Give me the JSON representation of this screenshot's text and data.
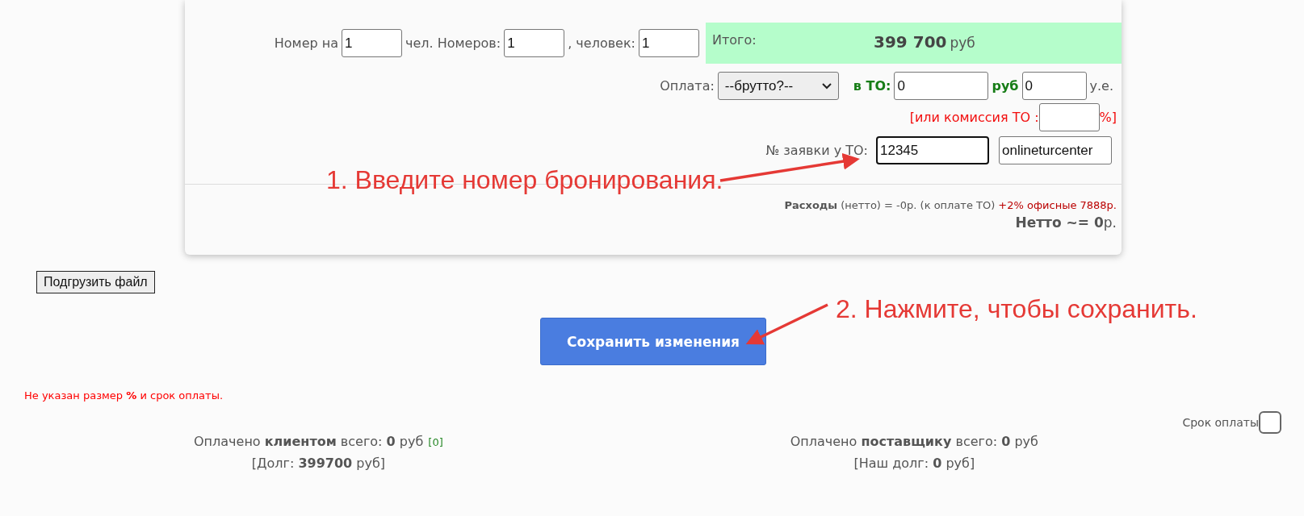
{
  "room_row": {
    "fields": [
      {
        "label": "Номер на",
        "value": "1"
      },
      {
        "label": "чел. Номеров:",
        "value": "1"
      },
      {
        "label": ", человек:",
        "value": "1"
      }
    ]
  },
  "total": {
    "label": "Итого:",
    "amount": "399 700",
    "currency": "руб"
  },
  "payment": {
    "label": "Оплата:",
    "select": "--брутто?--",
    "to_label": "в ТО:",
    "to_value": "0",
    "rub_label": "руб",
    "ue_value": "0",
    "ue_label": "у.е."
  },
  "commission": {
    "label": "[или комиссия ТО :",
    "suffix": "%]"
  },
  "order": {
    "label": "№ заявки у ТО:",
    "value": "12345",
    "focused": true,
    "operator": "onlineturcenter"
  },
  "expenses": {
    "text": "**Расходы** (нетто) = -0р. (к оплате ТО)",
    "extra": "+2% офисные 7888р."
  },
  "netto": "**Нетто ~= 0**р.",
  "upload_button": "Подгрузить файл",
  "save_button": "Сохранить изменения",
  "warning": "Не указан размер **%** и срок оплаты.",
  "due_date": {
    "label": "Срок оплаты",
    "checked": false
  },
  "client": {
    "paid": "Оплачено **клиентом** всего: **0** руб",
    "count": "[0]",
    "debt": "[Долг: **399700** руб]"
  },
  "supplier": {
    "paid": "Оплачено **поставщику** всего: **0** руб",
    "debt": "[Наш долг: **0** руб]"
  },
  "annotations": [
    {
      "text": "1. Введите номер бронирования."
    },
    {
      "text": "2. Нажмите, чтобы сохранить."
    }
  ]
}
